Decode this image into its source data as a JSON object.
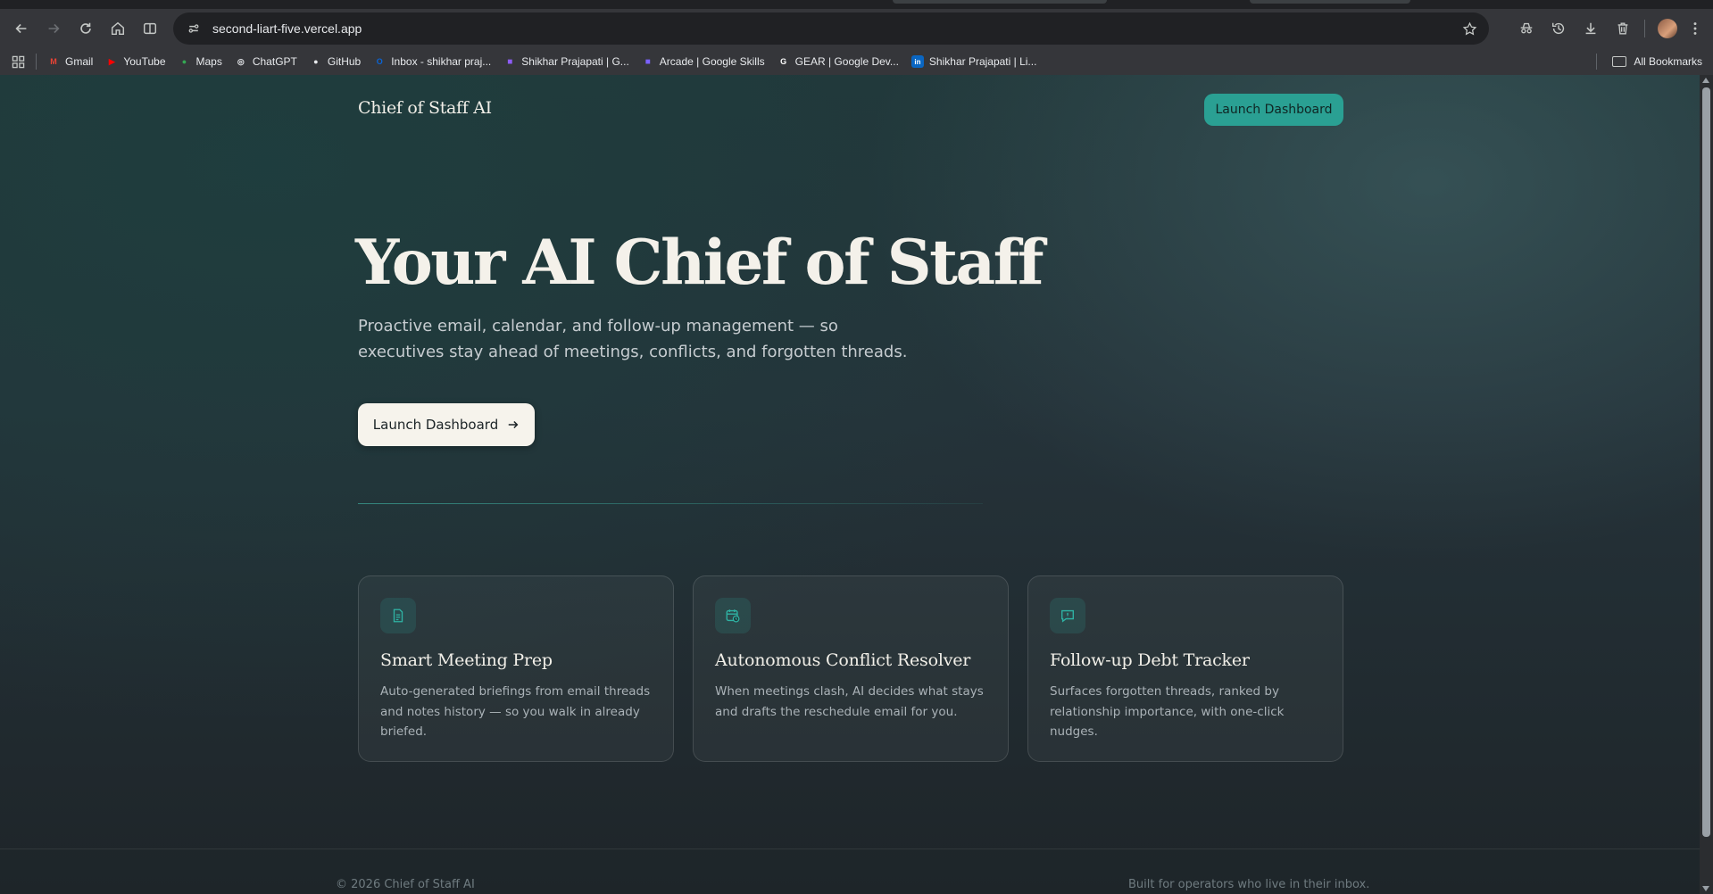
{
  "browser": {
    "url": "second-liart-five.vercel.app",
    "bookmarks": [
      {
        "label": "Gmail",
        "icon": "gmail-icon",
        "color": "#ea4335"
      },
      {
        "label": "YouTube",
        "icon": "youtube-icon",
        "color": "#ff0000"
      },
      {
        "label": "Maps",
        "icon": "maps-icon",
        "color": "#34a853"
      },
      {
        "label": "ChatGPT",
        "icon": "chatgpt-icon",
        "color": "#e8eaed"
      },
      {
        "label": "GitHub",
        "icon": "github-icon",
        "color": "#e8eaed"
      },
      {
        "label": "Inbox - shikhar praj...",
        "icon": "outlook-icon",
        "color": "#0a64d6"
      },
      {
        "label": "Shikhar Prajapati | G...",
        "icon": "purple-icon",
        "color": "#8e5cf7"
      },
      {
        "label": "Arcade | Google Skills",
        "icon": "arcade-icon",
        "color": "#7b61ff"
      },
      {
        "label": "GEAR | Google Dev...",
        "icon": "google-icon",
        "color": "#ffffff"
      },
      {
        "label": "Shikhar Prajapati | Li...",
        "icon": "linkedin-icon",
        "color": "#0a66c2"
      }
    ],
    "all_bookmarks": "All Bookmarks"
  },
  "header": {
    "brand": "Chief of Staff AI",
    "cta": "Launch Dashboard"
  },
  "hero": {
    "title": "Your AI Chief of Staff",
    "subtitle": "Proactive email, calendar, and follow-up management — so executives stay ahead of meetings, conflicts, and forgotten threads.",
    "cta": "Launch Dashboard"
  },
  "features": [
    {
      "title": "Smart Meeting Prep",
      "description": "Auto-generated briefings from email threads and notes history — so you walk in already briefed.",
      "icon": "document-icon"
    },
    {
      "title": "Autonomous Conflict Resolver",
      "description": "When meetings clash, AI decides what stays and drafts the reschedule email for you.",
      "icon": "calendar-clock-icon"
    },
    {
      "title": "Follow-up Debt Tracker",
      "description": "Surfaces forgotten threads, ranked by relationship importance, with one-click nudges.",
      "icon": "message-icon"
    }
  ],
  "footer": {
    "left": "© 2026 Chief of Staff AI",
    "right": "Built for operators who live in their inbox."
  },
  "colors": {
    "accent": "#2aa093",
    "hero_text": "#f4f1ea"
  }
}
